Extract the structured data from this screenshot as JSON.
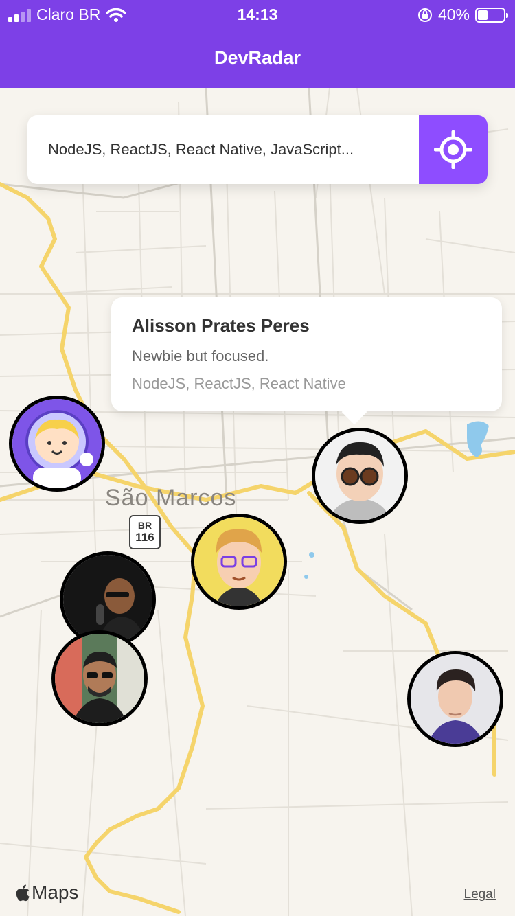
{
  "status_bar": {
    "carrier": "Claro BR",
    "time": "14:13",
    "battery_percent": "40%"
  },
  "app": {
    "title": "DevRadar",
    "accent_color": "#7d40e7"
  },
  "search": {
    "value": "NodeJS, ReactJS, React Native, JavaScript...",
    "locate_icon": "crosshair-icon"
  },
  "map": {
    "city_label": "São Marcos",
    "highway_shield": {
      "prefix": "BR",
      "number": "116"
    },
    "attribution": "Maps",
    "legal_link": "Legal"
  },
  "callout": {
    "name": "Alisson Prates Peres",
    "bio": "Newbie but focused.",
    "techs": "NodeJS, ReactJS, React Native"
  },
  "markers": [
    {
      "id": "astronaut",
      "icon": "astronaut-avatar"
    },
    {
      "id": "glasses-boy",
      "icon": "cartoon-glasses-avatar"
    },
    {
      "id": "blond-glasses",
      "icon": "cartoon-blond-avatar"
    },
    {
      "id": "mic-man",
      "icon": "photo-avatar"
    },
    {
      "id": "sunglasses-man",
      "icon": "photo-avatar"
    },
    {
      "id": "young-man",
      "icon": "photo-avatar"
    }
  ]
}
